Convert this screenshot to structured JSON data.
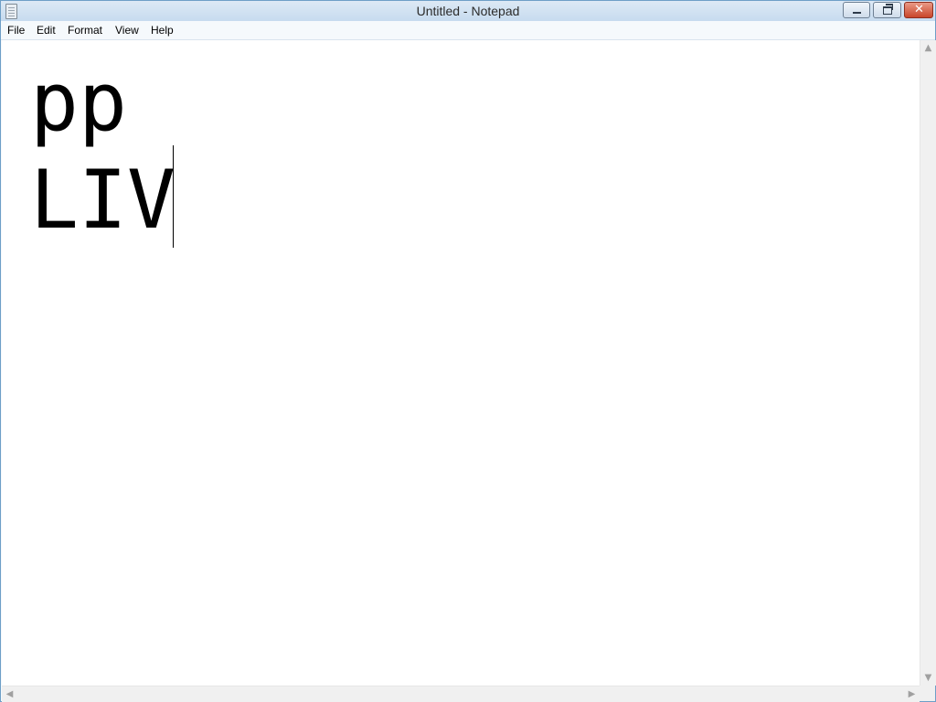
{
  "window": {
    "title": "Untitled - Notepad",
    "controls": {
      "minimize_icon": "minimize-icon",
      "maximize_icon": "restore-icon",
      "close_glyph": "✕"
    }
  },
  "menu": {
    "file": "File",
    "edit": "Edit",
    "format": "Format",
    "view": "View",
    "help": "Help"
  },
  "editor": {
    "lines": [
      "pp",
      "LIV"
    ]
  },
  "scrollbars": {
    "up_glyph": "▲",
    "down_glyph": "▼",
    "left_glyph": "◀",
    "right_glyph": "▶"
  },
  "colors": {
    "titlebar": "#c7dbef",
    "close_button": "#c9452a",
    "editor_background": "#ffffff"
  }
}
